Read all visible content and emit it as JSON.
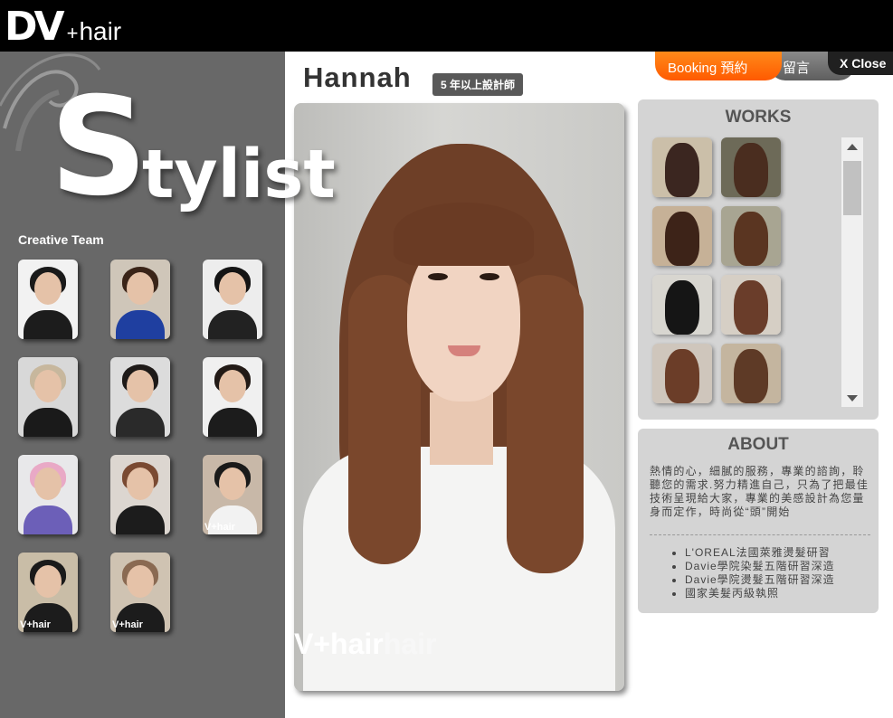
{
  "brand": {
    "logo_main": "DV",
    "logo_plus": "+",
    "logo_hair": "hair"
  },
  "sidebar": {
    "title_initial": "S",
    "title_rest": "tylist",
    "team_label": "Creative Team",
    "stylists": [
      {
        "name": "stylist-1",
        "bg": "#f2f2f2",
        "hair": "#1a1a1a",
        "body": "#1c1c1c"
      },
      {
        "name": "stylist-2",
        "bg": "#cfc6b9",
        "hair": "#3a2418",
        "body": "#1f3fa0"
      },
      {
        "name": "stylist-3",
        "bg": "#ededed",
        "hair": "#141414",
        "body": "#222222"
      },
      {
        "name": "stylist-4",
        "bg": "#d8d8d8",
        "hair": "#c7b79d",
        "body": "#1a1a1a"
      },
      {
        "name": "stylist-5",
        "bg": "#dcdcdc",
        "hair": "#1e1a18",
        "body": "#2a2a2a"
      },
      {
        "name": "stylist-6",
        "bg": "#f0f0f0",
        "hair": "#221a16",
        "body": "#1c1c1c"
      },
      {
        "name": "stylist-7",
        "bg": "#e8e8ea",
        "hair": "#e9a9c6",
        "body": "#6c5fb8"
      },
      {
        "name": "stylist-8",
        "bg": "#dcd6d0",
        "hair": "#7a4a32",
        "body": "#1c1c1c"
      },
      {
        "name": "stylist-9",
        "bg": "#c8b8a8",
        "hair": "#1a1a1a",
        "body": "#f2f2f2"
      },
      {
        "name": "stylist-10",
        "bg": "#c9bda7",
        "hair": "#1a1a1a",
        "body": "#1c1c1c"
      },
      {
        "name": "stylist-11",
        "bg": "#cfc3b2",
        "hair": "#8a6a52",
        "body": "#1c1c1c"
      }
    ],
    "watermark": "V+hair"
  },
  "header": {
    "stylist_name": "Hannah",
    "badge": "5 年以上設計師",
    "booking_label": "Booking 預約",
    "message_label": "留言",
    "close_label": "X Close"
  },
  "portrait": {
    "watermark_dv": "V",
    "watermark_plus": "+hair",
    "watermark_ghost": "hair"
  },
  "works": {
    "title": "WORKS",
    "items": [
      {
        "bg": "#cbbfa9",
        "hair": "#3b2620"
      },
      {
        "bg": "#6d6a58",
        "hair": "#4a2d1f"
      },
      {
        "bg": "#c6b197",
        "hair": "#3d2318"
      },
      {
        "bg": "#a8a592",
        "hair": "#5a3521"
      },
      {
        "bg": "#d8d6d0",
        "hair": "#151515"
      },
      {
        "bg": "#d6cfc5",
        "hair": "#6a3d2a"
      },
      {
        "bg": "#cfc6bc",
        "hair": "#6b3d28"
      },
      {
        "bg": "#c4b59f",
        "hair": "#5e3a26"
      }
    ]
  },
  "about": {
    "title": "ABOUT",
    "description": "熱情的心，細膩的服務，專業的諮詢，聆聽您的需求.努力精進自己，只為了把最佳技術呈現給大家，專業的美感設計為您量身而定作，時尚從“頭”開始",
    "credentials": [
      "L'OREAL法國萊雅燙髮研習",
      "Davie學院染髮五階研習深造",
      "Davie學院燙髮五階研習深造",
      "國家美髮丙級執照"
    ]
  },
  "colors": {
    "booking": "#ff6a00",
    "sidebar_bg": "#686868",
    "panel_bg": "#d4d4d4"
  }
}
